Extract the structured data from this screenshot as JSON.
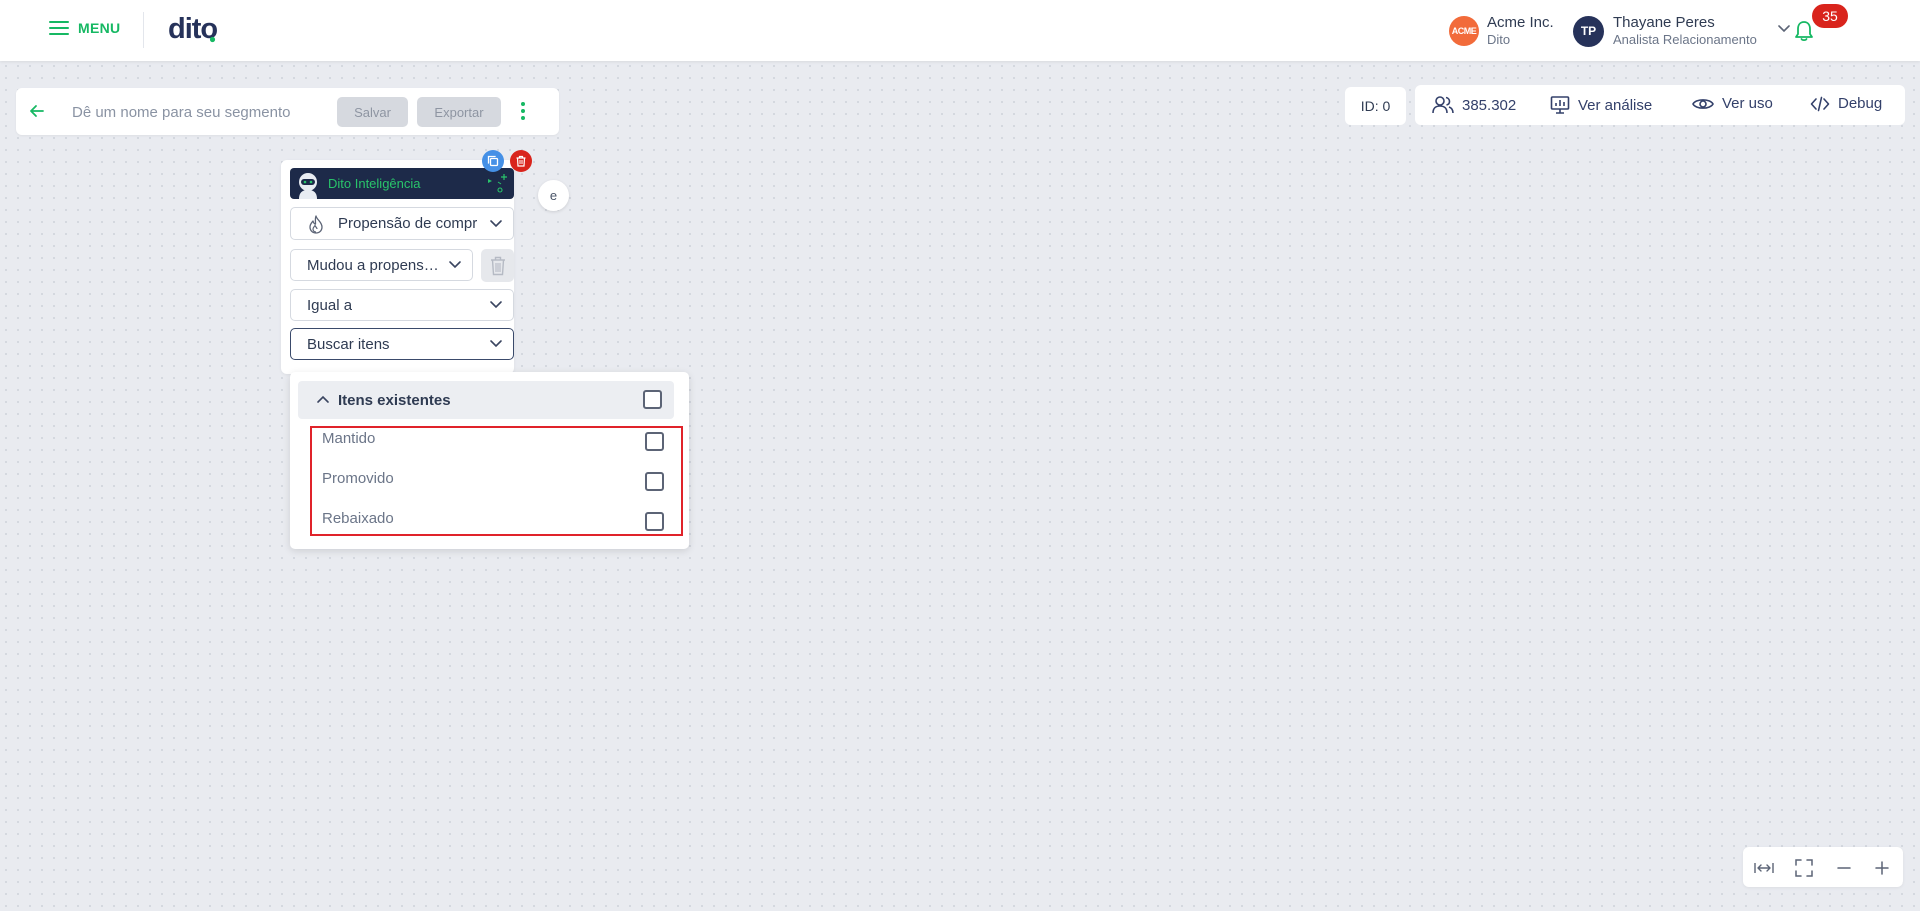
{
  "header": {
    "menu_label": "MENU",
    "logo_text": "dito",
    "org": {
      "badge": "ACME",
      "name": "Acme Inc.",
      "sub": "Dito"
    },
    "user": {
      "initials": "TP",
      "name": "Thayane Peres",
      "role": "Analista Relacionamento"
    },
    "notifications_count": "35"
  },
  "segment": {
    "name_placeholder": "Dê um nome para seu segmento",
    "save_label": "Salvar",
    "export_label": "Exportar"
  },
  "stats": {
    "id_label": "ID: 0",
    "users_count": "385.302",
    "view_analysis": "Ver análise",
    "view_usage": "Ver uso",
    "debug": "Debug"
  },
  "node": {
    "banner_title": "Dito Inteligência",
    "connector_label": "e",
    "field1": "Propensão de compra",
    "field2": "Mudou a propensão",
    "operator": "Igual a",
    "search": "Buscar itens"
  },
  "dropdown": {
    "group_label": "Itens existentes",
    "options": [
      "Mantido",
      "Promovido",
      "Rebaixado"
    ]
  },
  "colors": {
    "brand_green": "#16b863",
    "banner_navy": "#1d2a49",
    "alert_red": "#d9241c",
    "highlight_red": "#e0232a",
    "accent_blue": "#4590e6"
  }
}
